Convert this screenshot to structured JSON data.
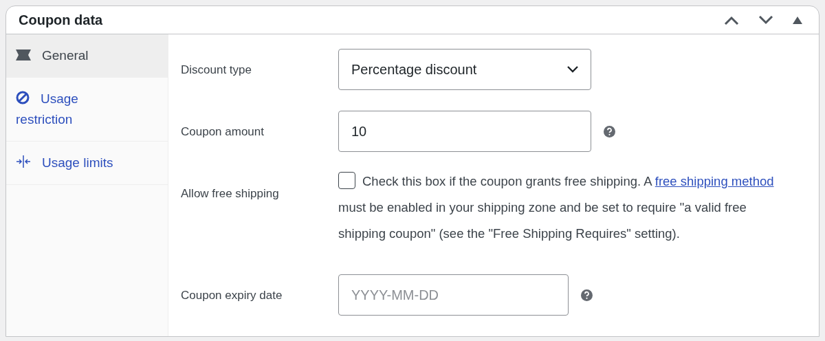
{
  "panel": {
    "title": "Coupon data"
  },
  "tabs": [
    {
      "label": "General",
      "selected": true
    },
    {
      "label": "Usage restriction",
      "selected": false
    },
    {
      "label": "Usage limits",
      "selected": false
    }
  ],
  "fields": [
    {
      "kind": "select",
      "label": "Discount type",
      "value": "Percentage discount",
      "help": false
    },
    {
      "kind": "text",
      "label": "Coupon amount",
      "value": "10",
      "help": true
    },
    {
      "kind": "checkbox",
      "label": "Allow free shipping",
      "checked": false,
      "description_before": "Check this box if the coupon grants free shipping. A ",
      "link": "free shipping method",
      "description_after": " must be enabled in your shipping zone and be set to require \"a valid free shipping coupon\" (see the \"Free Shipping Requires\" setting).",
      "help": false
    },
    {
      "kind": "date",
      "label": "Coupon expiry date",
      "placeholder": "YYYY-MM-DD",
      "help": true
    }
  ]
}
